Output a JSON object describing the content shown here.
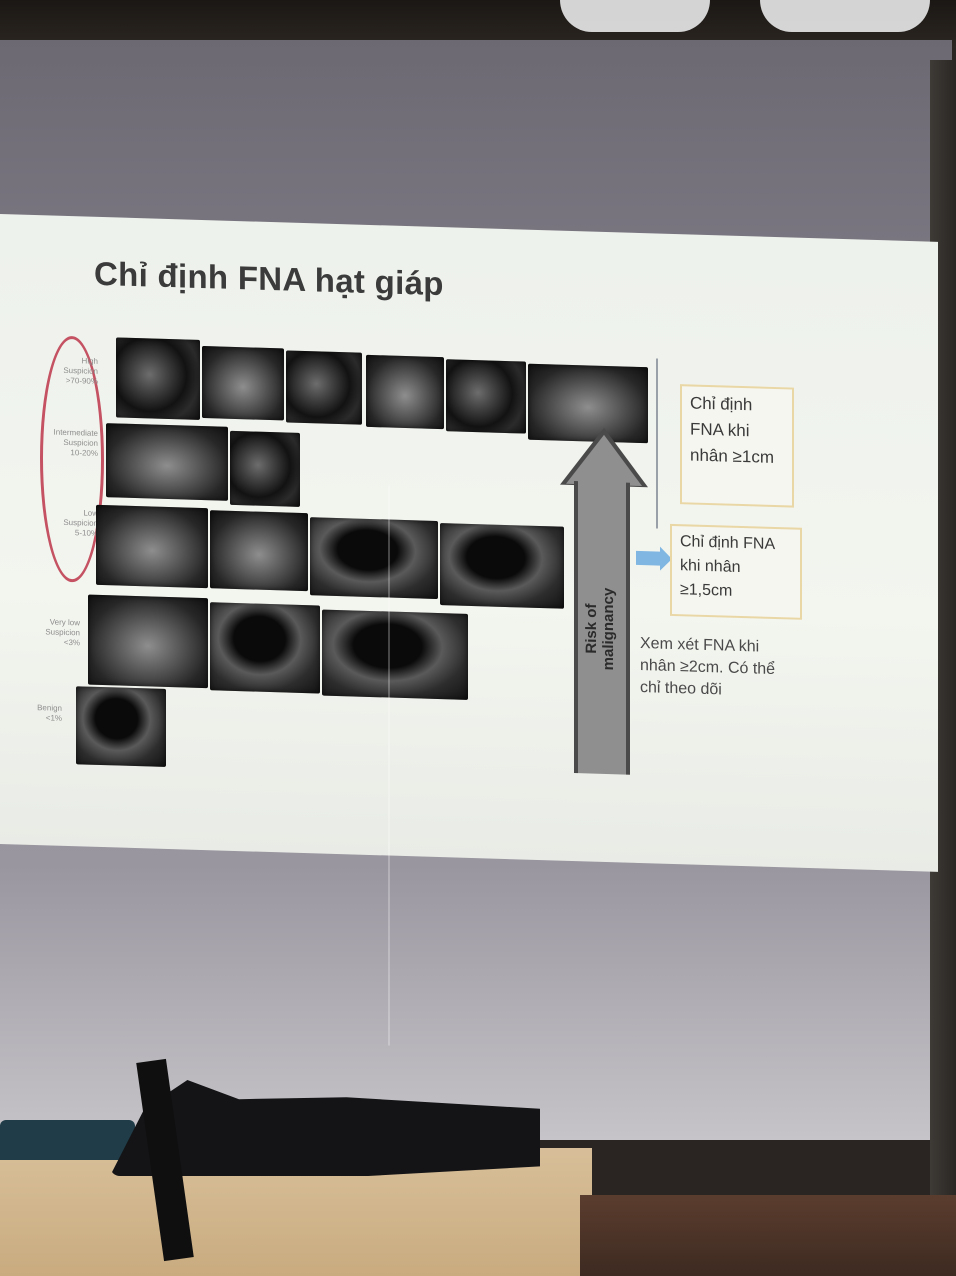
{
  "slide": {
    "title": "Chỉ định FNA hạt giáp",
    "categories": [
      {
        "name": "High Suspicion",
        "range": ">70-90%"
      },
      {
        "name": "Intermediate Suspicion",
        "range": "10-20%"
      },
      {
        "name": "Low Suspicion",
        "range": "5-10%"
      },
      {
        "name": "Very low Suspicion",
        "range": "<3%"
      },
      {
        "name": "Benign",
        "range": "<1%"
      }
    ],
    "arrow_label": "Risk of malignancy",
    "box1": "Chỉ định FNA khi nhân ≥1cm",
    "box2": "Chỉ định FNA khi nhân ≥1,5cm",
    "note": "Xem xét FNA khi nhân ≥2cm. Có thể chỉ theo dõi"
  }
}
